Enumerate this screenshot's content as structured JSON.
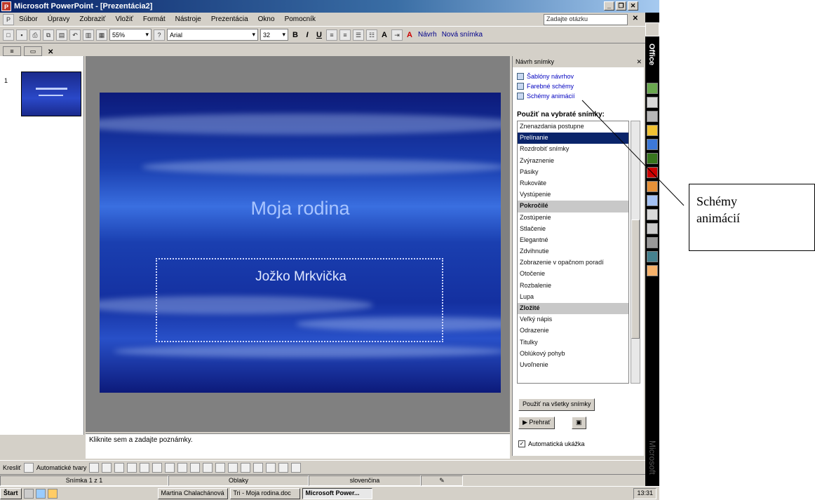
{
  "window": {
    "title": "Microsoft PowerPoint - [Prezentácia2]"
  },
  "menu": {
    "items": [
      "Súbor",
      "Úpravy",
      "Zobraziť",
      "Vložiť",
      "Formát",
      "Nástroje",
      "Prezentácia",
      "Okno",
      "Pomocník"
    ],
    "help_placeholder": "Zadajte otázku"
  },
  "toolbar": {
    "zoom": "55%",
    "font": "Arial",
    "font_size": "32",
    "design_label": "Návrh",
    "new_slide_label": "Nová snímka"
  },
  "office_bar": {
    "label": "Office",
    "brand": "Microsoft"
  },
  "slides_pane": {
    "slide_number": "1"
  },
  "slide": {
    "title": "Moja rodina",
    "subtitle": "Jožko Mrkvička"
  },
  "notes": {
    "placeholder": "Kliknite sem a zadajte poznámky."
  },
  "task_pane": {
    "header": "Návrh snímky",
    "links": [
      "Šablóny návrhov",
      "Farebné schémy",
      "Schémy animácií"
    ],
    "apply_label": "Použiť na vybraté snímky:",
    "schemes": [
      {
        "label": "Znenazdania postupne",
        "type": "item"
      },
      {
        "label": "Prelínanie",
        "type": "selected"
      },
      {
        "label": "Rozdrobiť snímky",
        "type": "item"
      },
      {
        "label": "Zvýraznenie",
        "type": "item"
      },
      {
        "label": "Pásiky",
        "type": "item"
      },
      {
        "label": "Rukoväte",
        "type": "item"
      },
      {
        "label": "Vystúpenie",
        "type": "item"
      },
      {
        "label": "Pokročilé",
        "type": "category"
      },
      {
        "label": "Zostúpenie",
        "type": "item"
      },
      {
        "label": "Stlačenie",
        "type": "item"
      },
      {
        "label": "Elegantné",
        "type": "item"
      },
      {
        "label": "Zdvihnutie",
        "type": "item"
      },
      {
        "label": "Zobrazenie v opačnom poradí",
        "type": "item"
      },
      {
        "label": "Otočenie",
        "type": "item"
      },
      {
        "label": "Rozbalenie",
        "type": "item"
      },
      {
        "label": "Lupa",
        "type": "item"
      },
      {
        "label": "Zložité",
        "type": "category"
      },
      {
        "label": "Veľký nápis",
        "type": "item"
      },
      {
        "label": "Odrazenie",
        "type": "item"
      },
      {
        "label": "Titulky",
        "type": "item"
      },
      {
        "label": "Oblúkový pohyb",
        "type": "item"
      },
      {
        "label": "Uvoľnenie",
        "type": "item"
      }
    ],
    "apply_all_label": "Použiť na všetky snímky",
    "play_label": "Prehrať",
    "autopreview_label": "Automatická ukážka",
    "autopreview_checked": "✓"
  },
  "draw_toolbar": {
    "draw_label": "Kresliť",
    "autoshapes_label": "Automatické tvary"
  },
  "status": {
    "slide": "Snímka 1 z 1",
    "design": "Oblaky",
    "language": "slovenčina"
  },
  "taskbar": {
    "start_label": "Štart",
    "tasks": [
      "Martina Chalachánová",
      "Tri - Moja rodina.doc",
      "Microsoft Power..."
    ],
    "time": "13:31"
  },
  "callout": {
    "line1": "Schémy",
    "line2": "animácií"
  },
  "colors": {
    "titlebar": "#0a246a",
    "selected_item": "#0a246a",
    "slide_bg": "#1a3fb0"
  }
}
